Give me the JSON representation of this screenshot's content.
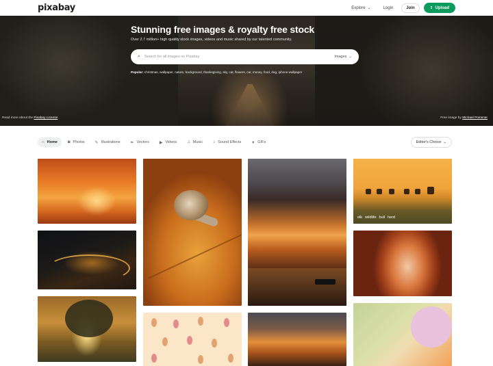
{
  "header": {
    "logo": "pixabay",
    "explore": "Explore",
    "login": "Login",
    "join": "Join",
    "upload": "Upload"
  },
  "hero": {
    "title": "Stunning free images & royalty free stock",
    "subtitle": "Over 2.7 million+ high quality stock images, videos and music shared by our talented community.",
    "search_placeholder": "Search for all images on Pixabay",
    "search_type": "Images",
    "popular_label": "Popular:",
    "popular_terms": "christmas, wallpaper, nature, background, thanksgiving, sky, cat, flowers, car, money, food, dog, iphone wallpaper",
    "license_text": "Read more about the ",
    "license_link": "Pixabay License",
    "credit_text": "Free image by ",
    "credit_link": "Michael Poinsner"
  },
  "tabs": [
    {
      "label": "Home",
      "icon": "home-icon"
    },
    {
      "label": "Photos",
      "icon": "camera-icon"
    },
    {
      "label": "Illustrations",
      "icon": "brush-icon"
    },
    {
      "label": "Vectors",
      "icon": "pen-icon"
    },
    {
      "label": "Videos",
      "icon": "video-icon"
    },
    {
      "label": "Music",
      "icon": "music-icon"
    },
    {
      "label": "Sound Effects",
      "icon": "sound-icon"
    },
    {
      "label": "GIFs",
      "icon": "gif-icon"
    }
  ],
  "sort": {
    "label": "Editor's Choice"
  },
  "tile_tags": [
    "elk",
    "wildlife",
    "bull",
    "herd"
  ]
}
